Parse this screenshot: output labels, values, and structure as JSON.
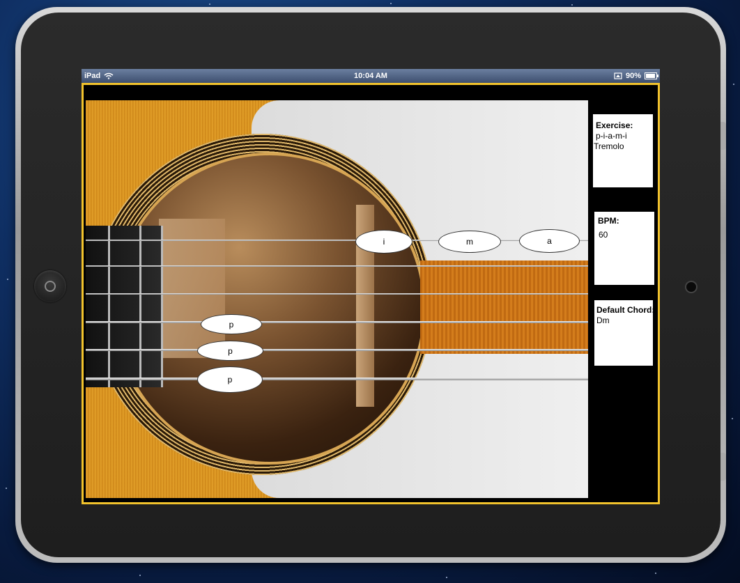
{
  "status_bar": {
    "carrier": "iPad",
    "time": "10:04 AM",
    "battery": "90%",
    "battery_level": 0.9
  },
  "fingers": {
    "i": "i",
    "m": "m",
    "a": "a",
    "p1": "p",
    "p2": "p",
    "p3": "p"
  },
  "panel": {
    "exercise_label": "Exercise:",
    "exercise_line1": "p-i-a-m-i",
    "exercise_line2": "Tremolo",
    "bpm_label": "BPM:",
    "bpm_value": "60",
    "chord_label": "Default Chord:",
    "chord_value": "Dm"
  },
  "colors": {
    "frame_accent": "#f2c32c",
    "status_bar": "#4a5b7b"
  },
  "icons": {
    "wifi": "wifi-icon",
    "orientation_lock": "orientation-lock-icon",
    "battery": "battery-icon"
  }
}
